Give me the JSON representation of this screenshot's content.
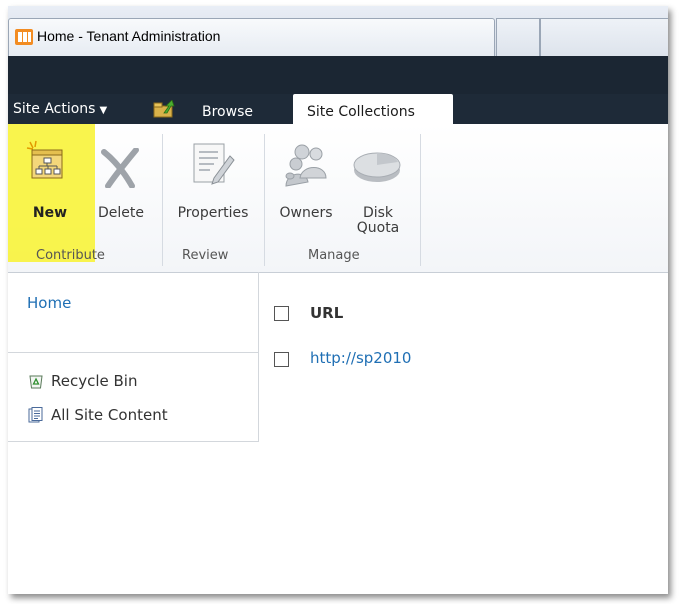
{
  "browser": {
    "tab_title": "Home - Tenant Administration"
  },
  "ribbon_tabs": {
    "site_actions": "Site Actions",
    "browse": "Browse",
    "site_collections": "Site Collections"
  },
  "ribbon": {
    "new_label": "New",
    "delete_label": "Delete",
    "properties_label": "Properties",
    "owners_label": "Owners",
    "disk_quota_line1": "Disk",
    "disk_quota_line2": "Quota",
    "group_contribute": "Contribute",
    "group_review": "Review",
    "group_manage": "Manage"
  },
  "leftnav": {
    "home": "Home",
    "recycle_bin": "Recycle Bin",
    "all_site_content": "All Site Content"
  },
  "list": {
    "column_url": "URL",
    "rows": [
      "http://sp2010"
    ]
  },
  "colors": {
    "ribbon_dark": "#1e2a38",
    "link": "#1f6fb4",
    "highlight": "#f8f33a"
  }
}
